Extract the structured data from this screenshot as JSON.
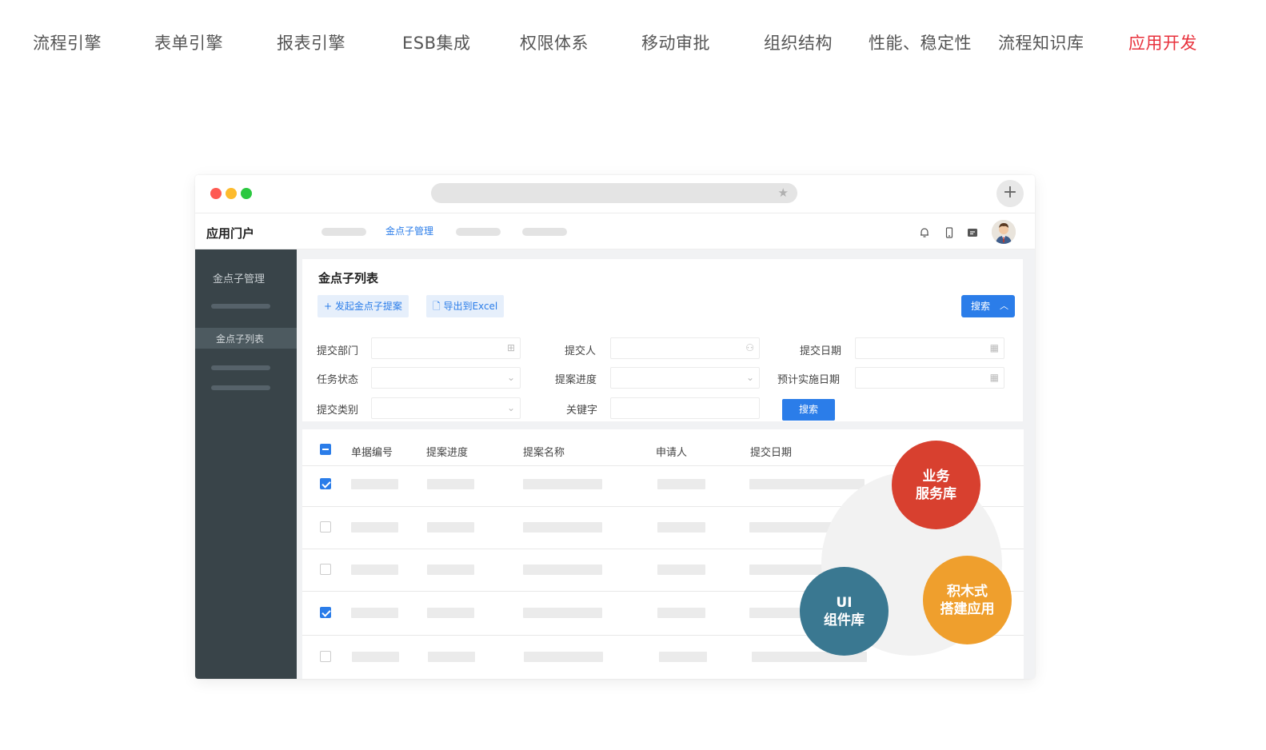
{
  "topnav": {
    "items": [
      {
        "label": "流程引擎"
      },
      {
        "label": "表单引擎"
      },
      {
        "label": "报表引擎"
      },
      {
        "label": "ESB集成"
      },
      {
        "label": "权限体系"
      },
      {
        "label": "移动审批"
      },
      {
        "label": "组织结构"
      },
      {
        "label": "性能、稳定性"
      },
      {
        "label": "流程知识库"
      },
      {
        "label": "应用开发"
      }
    ],
    "active_color": "#e8313c"
  },
  "browser": {
    "traffic_lights": [
      "#fe5a52",
      "#fdbb2d",
      "#2bc840"
    ],
    "new_tab_icon": "plus-icon",
    "bookmark_icon": "star-icon"
  },
  "app": {
    "brand": "应用门户",
    "active_tab": "金点子管理",
    "header_icons": [
      "bell-icon",
      "mobile-icon",
      "message-icon",
      "avatar"
    ],
    "accent": "#2b7de9"
  },
  "sidebar": {
    "title": "金点子管理",
    "active_item": "金点子列表"
  },
  "main": {
    "list_title": "金点子列表",
    "actions": {
      "create": "发起金点子提案",
      "export": "导出到Excel",
      "search_toggle": "搜索"
    },
    "filters": {
      "dept": "提交部门",
      "submitter": "提交人",
      "submit_date": "提交日期",
      "task_status": "任务状态",
      "progress": "提案进度",
      "plan_date": "预计实施日期",
      "category": "提交类别",
      "keyword": "关键字",
      "search_button": "搜索"
    },
    "table": {
      "columns": [
        "单据编号",
        "提案进度",
        "提案名称",
        "申请人",
        "提交日期"
      ],
      "rows_checked": [
        true,
        false,
        false,
        true,
        false
      ]
    }
  },
  "features": {
    "business": {
      "line1": "业务",
      "line2": "服务库",
      "color": "#d8402f"
    },
    "ui": {
      "line1": "UI",
      "line2": "组件库",
      "color": "#3a7891"
    },
    "blocks": {
      "line1": "积木式",
      "line2": "搭建应用",
      "color": "#ef9f2d"
    }
  }
}
